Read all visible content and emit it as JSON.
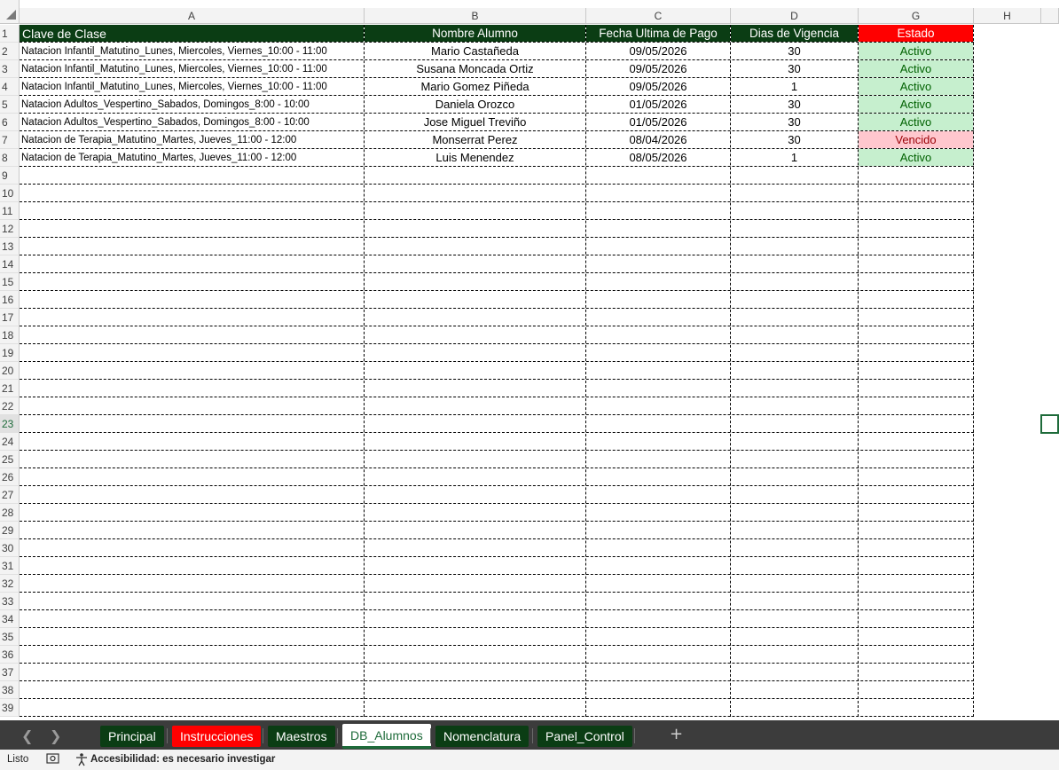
{
  "columns": [
    "A",
    "B",
    "C",
    "D",
    "G",
    "H"
  ],
  "row_numbers": [
    "1",
    "2",
    "3",
    "4",
    "5",
    "6",
    "7",
    "8",
    "9",
    "10",
    "11",
    "12",
    "13",
    "14",
    "15",
    "16",
    "17",
    "18",
    "19",
    "20",
    "21",
    "22",
    "23",
    "24",
    "25",
    "26",
    "27",
    "28",
    "29",
    "30",
    "31",
    "32",
    "33",
    "34",
    "35",
    "36",
    "37",
    "38",
    "39"
  ],
  "header_row": {
    "clave": "Clave de Clase",
    "nombre": "Nombre Alumno",
    "fecha": "Fecha Ultima de Pago",
    "dias": "Dias de Vigencia",
    "estado": "Estado"
  },
  "rows": [
    {
      "clave": "Natacion Infantil_Matutino_Lunes, Miercoles, Viernes_10:00 - 11:00",
      "nombre": "Mario Castañeda",
      "fecha": "09/05/2026",
      "dias": "30",
      "estado": "Activo"
    },
    {
      "clave": "Natacion Infantil_Matutino_Lunes, Miercoles, Viernes_10:00 - 11:00",
      "nombre": "Susana Moncada Ortiz",
      "fecha": "09/05/2026",
      "dias": "30",
      "estado": "Activo"
    },
    {
      "clave": "Natacion Infantil_Matutino_Lunes, Miercoles, Viernes_10:00 - 11:00",
      "nombre": "Mario Gomez Piñeda",
      "fecha": "09/05/2026",
      "dias": "1",
      "estado": "Activo"
    },
    {
      "clave": "Natacion Adultos_Vespertino_Sabados, Domingos_8:00 - 10:00",
      "nombre": "Daniela Orozco",
      "fecha": "01/05/2026",
      "dias": "30",
      "estado": "Activo"
    },
    {
      "clave": "Natacion Adultos_Vespertino_Sabados, Domingos_8:00 - 10:00",
      "nombre": "Jose Miguel Treviño",
      "fecha": "01/05/2026",
      "dias": "30",
      "estado": "Activo"
    },
    {
      "clave": "Natacion de Terapia_Matutino_Martes, Jueves_11:00 - 12:00",
      "nombre": "Monserrat Perez",
      "fecha": "08/04/2026",
      "dias": "30",
      "estado": "Vencido"
    },
    {
      "clave": "Natacion de Terapia_Matutino_Martes, Jueves_11:00 - 12:00",
      "nombre": "Luis Menendez",
      "fecha": "08/05/2026",
      "dias": "1",
      "estado": "Activo"
    }
  ],
  "colors": {
    "header_bg": "#0b3d14",
    "estado_header_bg": "#ff0000",
    "activo_bg": "#c6efce",
    "activo_text": "#006100",
    "vencido_bg": "#ffc7ce",
    "vencido_text": "#9c0006"
  },
  "sheet_tabs": [
    {
      "label": "Principal",
      "color": "#0b3d14",
      "active": false
    },
    {
      "label": "Instrucciones",
      "color": "#ff0000",
      "active": false
    },
    {
      "label": "Maestros",
      "color": "#0b3d14",
      "active": false
    },
    {
      "label": "DB_Alumnos",
      "color": "#ffffff",
      "active": true
    },
    {
      "label": "Nomenclatura",
      "color": "#0b3d14",
      "active": false
    },
    {
      "label": "Panel_Control",
      "color": "#0b3d14",
      "active": false
    }
  ],
  "tab_controls": {
    "prev_icon": "chevron-left-icon",
    "next_icon": "chevron-right-icon",
    "add_icon": "plus-icon"
  },
  "statusbar": {
    "ready": "Listo",
    "accessibility": "Accesibilidad: es necesario investigar"
  }
}
